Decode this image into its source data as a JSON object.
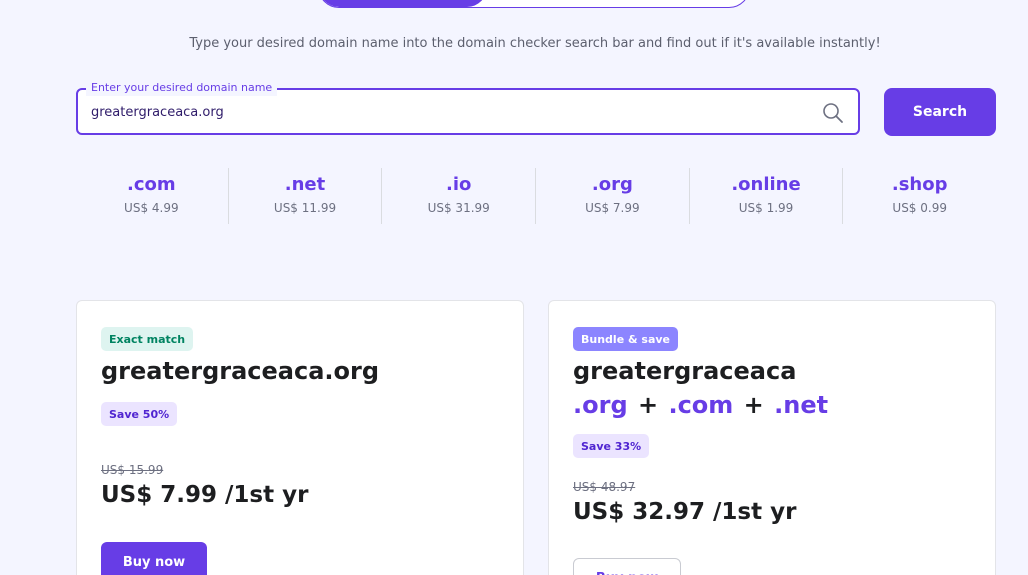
{
  "toggle": {
    "active_label": "",
    "inactive_label": ""
  },
  "subtitle": "Type your desired domain name into the domain checker search bar and find out if it's available instantly!",
  "search": {
    "label": "Enter your desired domain name",
    "value": "greatergraceaca.org",
    "button_label": "Search"
  },
  "tlds": [
    {
      "name": ".com",
      "price": "US$ 4.99"
    },
    {
      "name": ".net",
      "price": "US$ 11.99"
    },
    {
      "name": ".io",
      "price": "US$ 31.99"
    },
    {
      "name": ".org",
      "price": "US$ 7.99"
    },
    {
      "name": ".online",
      "price": "US$ 1.99"
    },
    {
      "name": ".shop",
      "price": "US$ 0.99"
    }
  ],
  "exact_card": {
    "badge": "Exact match",
    "domain": "greatergraceaca.org",
    "save_badge": "Save 50%",
    "old_price": "US$ 15.99",
    "new_price": "US$ 7.99 /1st yr",
    "buy_label": "Buy now"
  },
  "bundle_card": {
    "badge": "Bundle & save",
    "domain_base": "greatergraceaca",
    "ext1": ".org",
    "ext2": ".com",
    "ext3": ".net",
    "plus": "+",
    "save_badge": "Save 33%",
    "old_price": "US$ 48.97",
    "new_price": "US$ 32.97 /1st yr",
    "buy_label": "Buy now"
  },
  "colors": {
    "brand": "#673de6",
    "background": "#f4f5ff",
    "success": "#008361"
  }
}
